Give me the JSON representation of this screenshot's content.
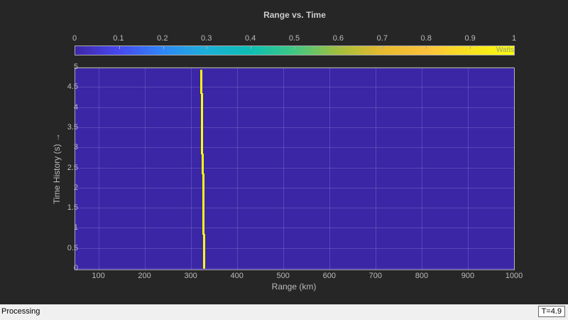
{
  "title": "Range vs. Time",
  "colorbar": {
    "ticks": [
      "0",
      "0.1",
      "0.2",
      "0.3",
      "0.4",
      "0.5",
      "0.6",
      "0.7",
      "0.8",
      "0.9",
      "1"
    ],
    "unit": "Watts"
  },
  "chart_data": {
    "type": "heatmap",
    "xlabel": "Range (km)",
    "ylabel": "Time History (s) →",
    "xlim": [
      50,
      1000
    ],
    "ylim": [
      0,
      5
    ],
    "xticks": [
      "100",
      "200",
      "300",
      "400",
      "500",
      "600",
      "700",
      "800",
      "900",
      "1000"
    ],
    "yticks": [
      "0",
      "0.5",
      "1",
      "1.5",
      "2",
      "2.5",
      "3",
      "3.5",
      "4",
      "4.5",
      "5"
    ],
    "trace": [
      {
        "t0": 0,
        "t1": 0.85,
        "range": 328
      },
      {
        "t0": 0.85,
        "t1": 1.35,
        "range": 327
      },
      {
        "t0": 1.35,
        "t1": 2.35,
        "range": 326
      },
      {
        "t0": 2.35,
        "t1": 2.85,
        "range": 325
      },
      {
        "t0": 2.85,
        "t1": 4.35,
        "range": 324
      },
      {
        "t0": 4.35,
        "t1": 4.93,
        "range": 322
      }
    ]
  },
  "status": {
    "text": "Processing",
    "time": "T=4.9"
  },
  "colors": {
    "background": "#3b26a6",
    "trace": "#f9fb0e"
  }
}
